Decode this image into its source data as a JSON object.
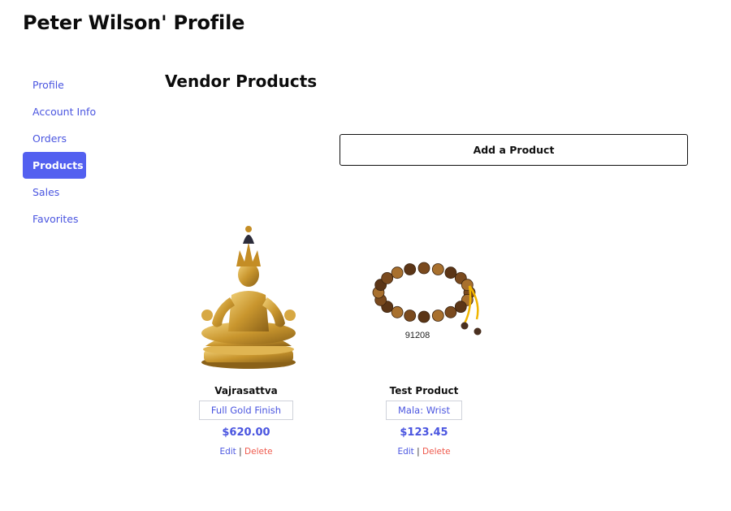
{
  "page": {
    "title": "Peter Wilson' Profile"
  },
  "sidebar": {
    "items": [
      {
        "label": "Profile",
        "active": false
      },
      {
        "label": "Account Info",
        "active": false
      },
      {
        "label": "Orders",
        "active": false
      },
      {
        "label": "Products",
        "active": true
      },
      {
        "label": "Sales",
        "active": false
      },
      {
        "label": "Favorites",
        "active": false
      }
    ]
  },
  "main": {
    "title": "Vendor Products",
    "add_button_label": "Add a Product",
    "products": [
      {
        "name": "Vajrasattva",
        "tag": "Full Gold Finish",
        "price": "$620.00",
        "edit_label": "Edit",
        "separator": "|",
        "delete_label": "Delete",
        "image": "golden-deity-statue"
      },
      {
        "name": "Test Product",
        "tag": "Mala: Wrist",
        "price": "$123.45",
        "edit_label": "Edit",
        "separator": "|",
        "delete_label": "Delete",
        "image": "tiger-eye-wrist-mala",
        "image_caption": "91208"
      }
    ]
  },
  "colors": {
    "accent": "#4a55e0",
    "active_bg": "#5360f0",
    "delete": "#ef5a4d"
  }
}
